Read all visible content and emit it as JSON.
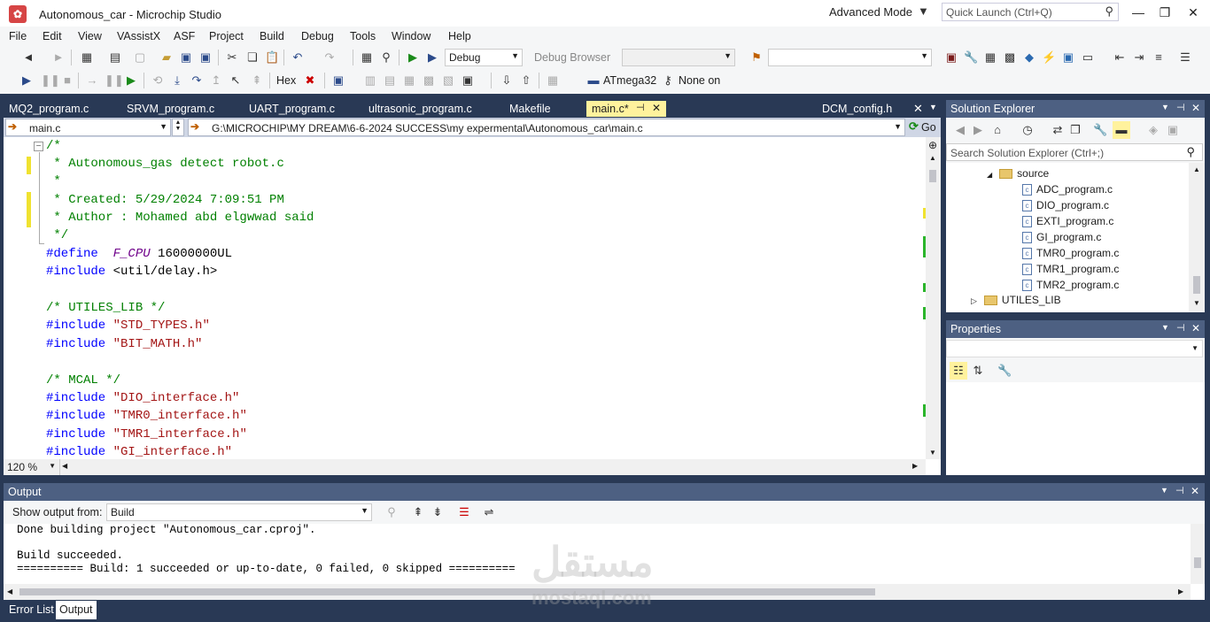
{
  "window": {
    "title": "Autonomous_car - Microchip Studio",
    "advanced_mode": "Advanced Mode",
    "quick_launch_placeholder": "Quick Launch (Ctrl+Q)"
  },
  "menu": [
    "File",
    "Edit",
    "View",
    "VAssistX",
    "ASF",
    "Project",
    "Build",
    "Debug",
    "Tools",
    "Window",
    "Help"
  ],
  "toolbar": {
    "config": "Debug",
    "debug_browser": "Debug Browser",
    "hex_label": "Hex",
    "device": "ATmega32",
    "tool": "None on"
  },
  "tabs": [
    {
      "label": "MQ2_program.c"
    },
    {
      "label": "SRVM_program.c"
    },
    {
      "label": "UART_program.c"
    },
    {
      "label": "ultrasonic_program.c"
    },
    {
      "label": "Makefile"
    },
    {
      "label": "main.c*"
    },
    {
      "label": "DCM_config.h"
    }
  ],
  "navbar": {
    "file": "main.c",
    "path": "G:\\MICROCHIP\\MY DREAM\\6-6-2024 SUCCESS\\my expermental\\Autonomous_car\\main.c",
    "go": "Go"
  },
  "code": [
    "/*",
    " * Autonomous_gas detect robot.c",
    " *",
    " * Created: 5/29/2024 7:09:51 PM",
    " * Author : Mohamed abd elgwwad said",
    " */",
    "#define",
    "F_CPU",
    "16000000UL",
    "#include",
    "<util/delay.h>",
    "/* UTILES_LIB */",
    "#include",
    "\"STD_TYPES.h\"",
    "#include",
    "\"BIT_MATH.h\"",
    "/* MCAL */",
    "#include",
    "\"DIO_interface.h\"",
    "#include",
    "\"TMR0_interface.h\"",
    "#include",
    "\"TMR1_interface.h\"",
    "#include",
    "\"GI_interface.h\""
  ],
  "zoom": "120 %",
  "solution_explorer": {
    "title": "Solution Explorer",
    "search_placeholder": "Search Solution Explorer (Ctrl+;)",
    "folder": "source",
    "files": [
      "ADC_program.c",
      "DIO_program.c",
      "EXTI_program.c",
      "GI_program.c",
      "TMR0_program.c",
      "TMR1_program.c",
      "TMR2_program.c"
    ],
    "folder2": "UTILES_LIB"
  },
  "properties": {
    "title": "Properties"
  },
  "output": {
    "title": "Output",
    "show_from_label": "Show output from:",
    "source": "Build",
    "lines": [
      "Done building project \"Autonomous_car.cproj\".",
      "",
      "Build succeeded.",
      "========== Build: 1 succeeded or up-to-date, 0 failed, 0 skipped =========="
    ]
  },
  "bottom_tabs": [
    "Error List",
    "Output"
  ],
  "watermark": {
    "arabic": "مستقل",
    "latin": "mostaql.com"
  },
  "colors": {
    "accent": "#293955",
    "active_tab": "#fff29d",
    "comment": "#008000",
    "directive": "#0000ff",
    "string": "#a31515"
  }
}
